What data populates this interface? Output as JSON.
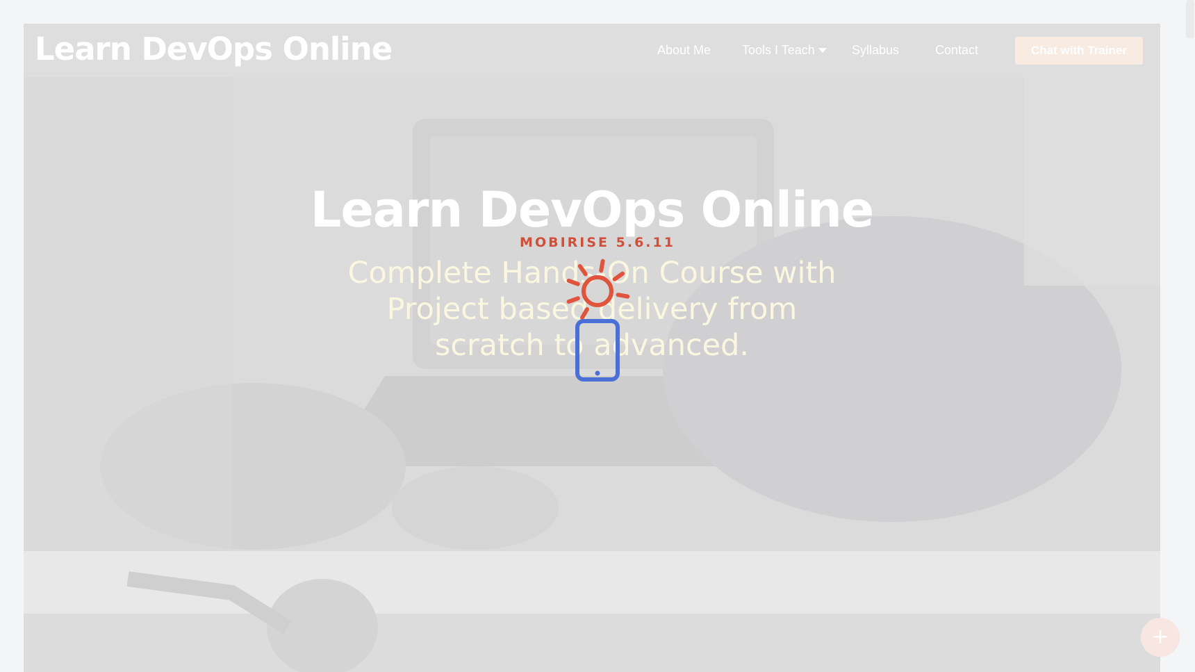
{
  "navbar": {
    "brand": "Learn DevOps Online",
    "links": [
      {
        "label": "About Me"
      },
      {
        "label": "Tools I Teach"
      },
      {
        "label": "Syllabus"
      },
      {
        "label": "Contact"
      }
    ],
    "cta_label": "Chat with Trainer"
  },
  "hero": {
    "title": "Learn DevOps Online",
    "subtitle": "Complete Hands-On Course with Project based delivery from scratch to advanced."
  },
  "loader": {
    "label": "MOBIRISE 5.6.11",
    "icon": "mobirise-sun-phone-icon",
    "sun_color": "#e0533d",
    "phone_color": "#4a6fd6"
  },
  "fab": {
    "icon": "plus-icon",
    "glyph": "+"
  },
  "colors": {
    "cta_bg": "#f7ebe2",
    "fab_bg": "#f8e6e3"
  }
}
